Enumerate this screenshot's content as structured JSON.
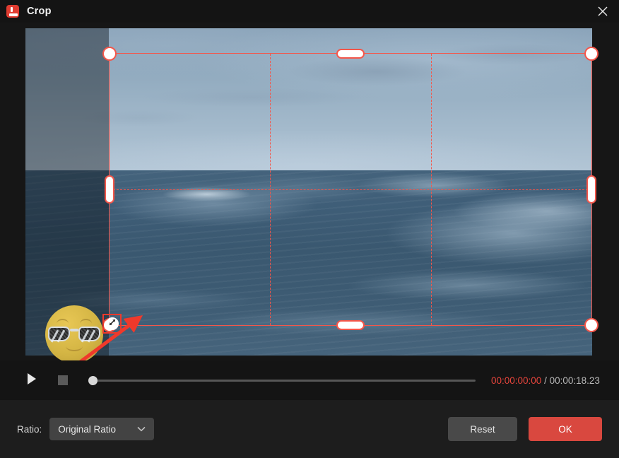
{
  "window": {
    "title": "Crop",
    "app_icon": "video-editor-icon",
    "close_icon": "close-icon"
  },
  "preview": {
    "scene_description": "ocean waves under overcast blue-grey sky",
    "sticker": {
      "name": "sunglasses-emoji-sticker",
      "resize_handle_icon": "diagonal-resize-arrow-icon"
    },
    "annotation": {
      "name": "red-pointer-arrow",
      "color": "#f0392b"
    },
    "crop": {
      "border_color": "#f4564a",
      "guide_style": "dashed-rule-of-thirds",
      "handles": [
        "top-left",
        "top-center",
        "top-right",
        "middle-left",
        "middle-right",
        "bottom-left",
        "bottom-center",
        "bottom-right"
      ]
    }
  },
  "player": {
    "play_icon": "play-icon",
    "stop_icon": "stop-icon",
    "seek_position_percent": 0,
    "time_current": "00:00:00:00",
    "time_separator": "/",
    "time_total": "00:00:18.23",
    "time_current_color": "#e8453c"
  },
  "footer": {
    "ratio_label": "Ratio:",
    "ratio_value": "Original Ratio",
    "ratio_chevron_icon": "chevron-down-icon",
    "reset_label": "Reset",
    "ok_label": "OK",
    "ok_color": "#d9483f"
  }
}
